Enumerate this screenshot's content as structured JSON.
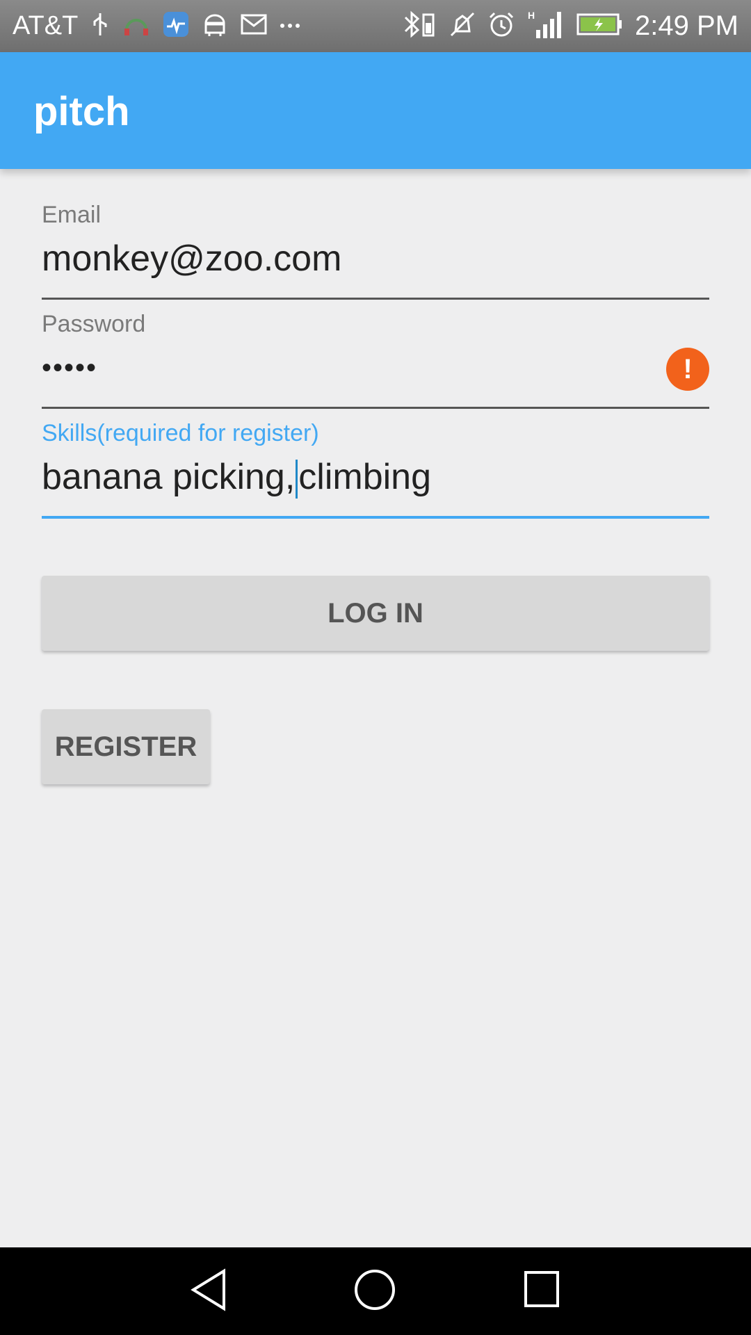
{
  "status_bar": {
    "carrier": "AT&T",
    "time": "2:49 PM",
    "left_icons": [
      "usb-icon",
      "headset-icon",
      "health-app-icon",
      "android-icon",
      "mail-icon",
      "more-dots-icon"
    ],
    "right_icons": [
      "bluetooth-battery-icon",
      "vibrate-off-icon",
      "alarm-icon",
      "signal-icon",
      "battery-charging-icon"
    ]
  },
  "app_bar": {
    "title": "pitch",
    "color": "#42a8f3"
  },
  "form": {
    "email": {
      "label": "Email",
      "value": "monkey@zoo.com"
    },
    "password": {
      "label": "Password",
      "value": "•••••",
      "error_icon": "alert-icon"
    },
    "skills": {
      "label": "Skills(required for register)",
      "value_before_cursor": "banana picking,",
      "value_after_cursor": "climbing"
    }
  },
  "buttons": {
    "login": "LOG IN",
    "register": "REGISTER"
  },
  "nav_bar": {
    "icons": [
      "back-icon",
      "home-icon",
      "recents-icon"
    ]
  }
}
